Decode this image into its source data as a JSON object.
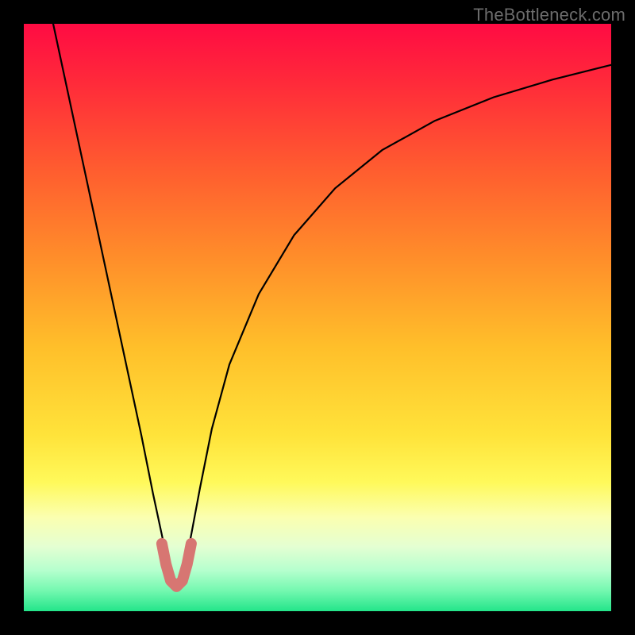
{
  "watermark": "TheBottleneck.com",
  "colors": {
    "page_bg": "#000000",
    "curve": "#000000",
    "marker": "#d77672"
  },
  "chart_data": {
    "type": "line",
    "title": "",
    "xlabel": "",
    "ylabel": "",
    "xlim": [
      0,
      100
    ],
    "ylim": [
      0,
      100
    ],
    "grid": false,
    "optimal_x": 26,
    "series": [
      {
        "name": "bottleneck_curve",
        "x": [
          5,
          8,
          11,
          14,
          17,
          20,
          22,
          23.5,
          24.5,
          25.5,
          26.5,
          27.5,
          28.5,
          30,
          32,
          35,
          40,
          46,
          53,
          61,
          70,
          80,
          90,
          100
        ],
        "y": [
          100,
          86,
          72,
          58,
          44,
          30,
          20,
          13,
          8,
          4.5,
          4.5,
          8,
          13,
          21,
          31,
          42,
          54,
          64,
          72,
          78.5,
          83.5,
          87.5,
          90.5,
          93
        ]
      },
      {
        "name": "optimal_marker",
        "x": [
          23.5,
          24.2,
          25.0,
          26.0,
          27.0,
          27.8,
          28.5
        ],
        "y": [
          11.5,
          8.0,
          5.2,
          4.2,
          5.2,
          8.0,
          11.5
        ]
      }
    ],
    "background_gradient": [
      {
        "offset": 0.0,
        "color": "#ff0b43"
      },
      {
        "offset": 0.1,
        "color": "#ff2a3a"
      },
      {
        "offset": 0.25,
        "color": "#ff5d2f"
      },
      {
        "offset": 0.4,
        "color": "#ff8e2a"
      },
      {
        "offset": 0.55,
        "color": "#ffbf2a"
      },
      {
        "offset": 0.7,
        "color": "#ffe33a"
      },
      {
        "offset": 0.78,
        "color": "#fff95a"
      },
      {
        "offset": 0.84,
        "color": "#fbffb0"
      },
      {
        "offset": 0.89,
        "color": "#e4ffd2"
      },
      {
        "offset": 0.93,
        "color": "#b6ffce"
      },
      {
        "offset": 0.965,
        "color": "#74f8b0"
      },
      {
        "offset": 1.0,
        "color": "#23e58a"
      }
    ]
  }
}
